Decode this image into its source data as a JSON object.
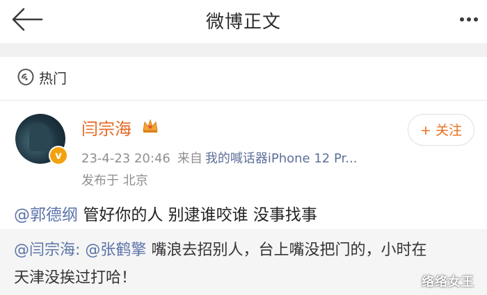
{
  "header": {
    "title": "微博正文",
    "back_icon": "back-arrow-icon",
    "more_icon": "more-dots-icon"
  },
  "hot": {
    "icon": "hot-topic-icon",
    "label": "热门"
  },
  "post": {
    "author": "闫宗海",
    "author_badge_icon": "crown-icon",
    "verified_icon": "verified-badge-icon",
    "follow_label": "+ 关注",
    "timestamp": "23-4-23 20:46",
    "from_label": "来自",
    "source": "我的喊话器iPhone 12 Pr...",
    "location": "发布于 北京",
    "mention": "@郭德纲",
    "text": "管好你的人 别逮谁咬谁 没事找事"
  },
  "repost": {
    "mention1": "@闫宗海:",
    "mention2": "@张鹤擎",
    "text1": "嘴浪去招别人，台上嘴没把门的，小时在",
    "text2": "天津没挨过打哈！"
  },
  "watermark": "络络女王",
  "colors": {
    "accent_orange": "#e86722",
    "link_blue": "#5a73a8",
    "meta_gray": "#8f8f8f",
    "badge_gold": "#f3a20f"
  }
}
